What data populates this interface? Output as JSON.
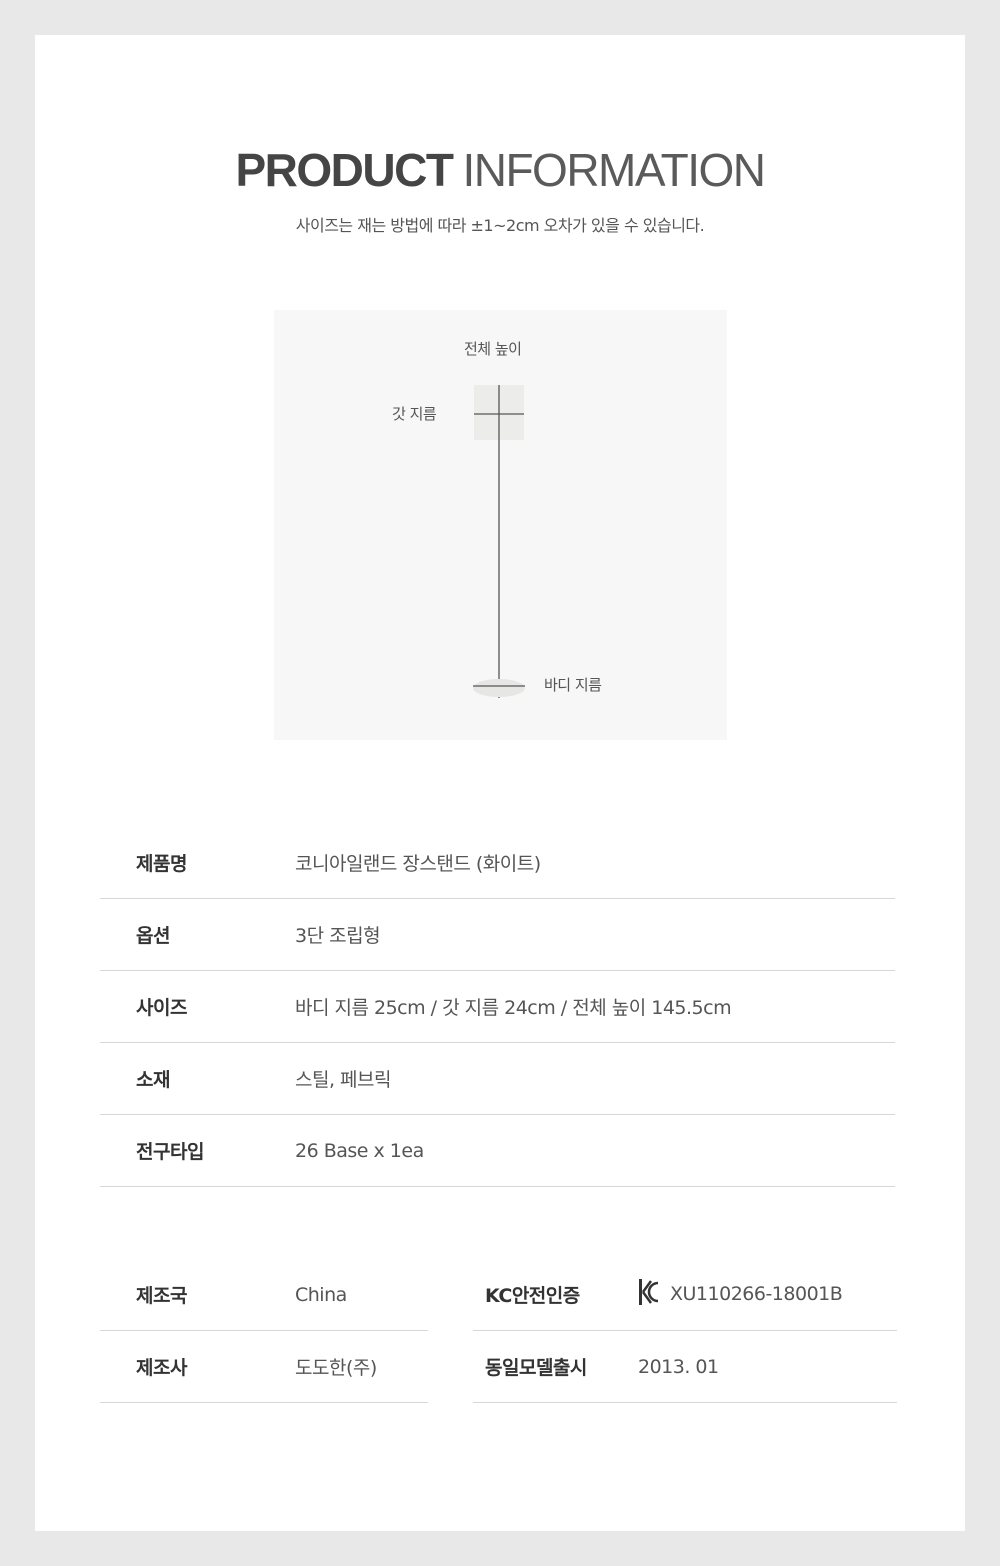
{
  "header": {
    "title_bold": "PRODUCT",
    "title_light": "INFORMATION",
    "subtitle": "사이즈는 재는 방법에 따라 ±1~2cm 오차가 있을 수 있습니다."
  },
  "diagram": {
    "label_height": "전체 높이",
    "label_shade": "갓 지름",
    "label_body": "바디 지름"
  },
  "specs": [
    {
      "key": "제품명",
      "value": "코니아일랜드 장스탠드 (화이트)"
    },
    {
      "key": "옵션",
      "value": "3단 조립형"
    },
    {
      "key": "사이즈",
      "value": "바디 지름 25cm / 갓 지름 24cm / 전체 높이 145.5cm"
    },
    {
      "key": "소재",
      "value": "스틸, 페브릭"
    },
    {
      "key": "전구타입",
      "value": "26 Base x 1ea"
    }
  ],
  "info_left": [
    {
      "key": "제조국",
      "value": "China"
    },
    {
      "key": "제조사",
      "value": "도도한(주)"
    }
  ],
  "info_right": [
    {
      "key": "KC안전인증",
      "value": "XU110266-18001B",
      "icon": "kc-mark-icon"
    },
    {
      "key": "동일모델출시",
      "value": "2013. 01"
    }
  ]
}
